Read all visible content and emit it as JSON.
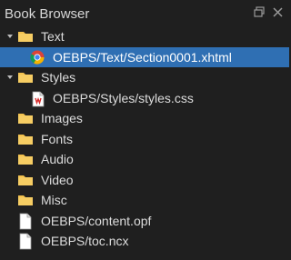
{
  "panel": {
    "title": "Book Browser",
    "controls": [
      "float-icon",
      "close-icon"
    ]
  },
  "tree": {
    "folders": {
      "text": "Text",
      "styles": "Styles",
      "images": "Images",
      "fonts": "Fonts",
      "audio": "Audio",
      "video": "Video",
      "misc": "Misc"
    },
    "files": {
      "section": "OEBPS/Text/Section0001.xhtml",
      "stylesheet": "OEBPS/Styles/styles.css",
      "opf": "OEBPS/content.opf",
      "ncx": "OEBPS/toc.ncx"
    },
    "selected": "OEBPS/Text/Section0001.xhtml"
  },
  "colors": {
    "background": "#1f1f1f",
    "selection": "#2f6fb3",
    "folder": "#f2c14e",
    "text": "#dcdcdc"
  },
  "icons": {
    "folder": "folder-icon",
    "xhtml": "chrome-icon",
    "css": "css-file-icon",
    "file": "file-icon",
    "expanded": "chevron-down-icon"
  }
}
